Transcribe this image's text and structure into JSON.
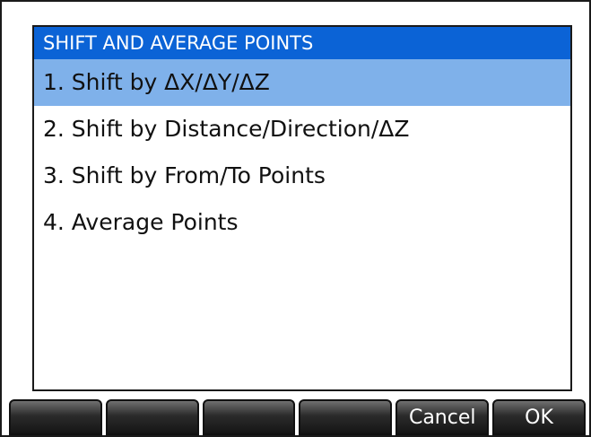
{
  "dialog": {
    "title": "SHIFT AND AVERAGE POINTS",
    "items": [
      {
        "label": "1. Shift by ΔX/ΔY/ΔZ",
        "selected": true
      },
      {
        "label": "2. Shift by Distance/Direction/ΔZ",
        "selected": false
      },
      {
        "label": "3. Shift by From/To Points",
        "selected": false
      },
      {
        "label": "4. Average Points",
        "selected": false
      }
    ]
  },
  "softkeys": [
    {
      "label": ""
    },
    {
      "label": ""
    },
    {
      "label": ""
    },
    {
      "label": ""
    },
    {
      "label": "Cancel"
    },
    {
      "label": "OK"
    }
  ],
  "colors": {
    "title_bar": "#0b63d6",
    "selection": "#7fb1ea",
    "softkey": "#222222"
  }
}
